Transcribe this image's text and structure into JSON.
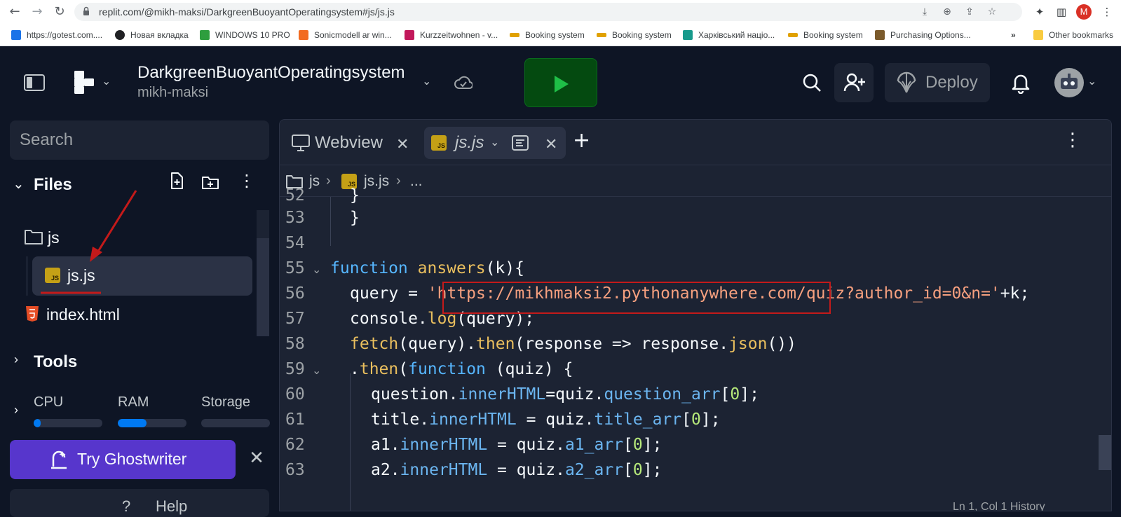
{
  "browser": {
    "url": "replit.com/@mikh-maksi/DarkgreenBuoyantOperatingsystem#js/js.js",
    "profile_initial": "M",
    "bookmarks": [
      {
        "label": "https://gotest.com....",
        "color": "#1a73e8"
      },
      {
        "label": "Новая вкладка",
        "color": "#202124"
      },
      {
        "label": "WINDOWS 10 PRO",
        "color": "#2e9e3e"
      },
      {
        "label": "Sonicmodell ar win...",
        "color": "#f26b21"
      },
      {
        "label": "Kurzzeitwohnen - v...",
        "color": "#c2185b"
      },
      {
        "label": "Booking system",
        "color": "#e0a100"
      },
      {
        "label": "Booking system",
        "color": "#e0a100"
      },
      {
        "label": "Харківський націо...",
        "color": "#179a8c"
      },
      {
        "label": "Booking system",
        "color": "#e0a100"
      },
      {
        "label": "Purchasing Options...",
        "color": "#7b5a2b"
      }
    ],
    "more_bookmarks": "»",
    "other_bookmarks": "Other bookmarks"
  },
  "header": {
    "repl_title": "DarkgreenBuoyantOperatingsystem",
    "owner": "mikh-maksi",
    "deploy_label": "Deploy"
  },
  "sidebar": {
    "search_placeholder": "Search",
    "files_label": "Files",
    "tree": [
      {
        "label": "js",
        "type": "folder"
      },
      {
        "label": "js.js",
        "type": "js",
        "selected": true
      },
      {
        "label": "index.html",
        "type": "html"
      }
    ],
    "tools_label": "Tools",
    "resources": [
      {
        "label": "CPU",
        "level": 0.1
      },
      {
        "label": "RAM",
        "level": 0.42
      },
      {
        "label": "Storage",
        "level": 0
      }
    ],
    "ghostwriter_label": "Try Ghostwriter",
    "help_label": "Help"
  },
  "editor": {
    "tabs": [
      {
        "label": "Webview",
        "active": false
      },
      {
        "label": "js.js",
        "active": true
      }
    ],
    "breadcrumb": [
      "js",
      "js.js",
      "..."
    ],
    "first_line_partial": "52",
    "line_numbers": [
      "53",
      "54",
      "55",
      "56",
      "57",
      "58",
      "59",
      "60",
      "61",
      "62",
      "63"
    ],
    "highlighted_url": "https://mikhmaksi2.pythonanywhere.com/",
    "status_text": "Ln 1, Col 1  History"
  },
  "colors": {
    "bg": "#0e1525",
    "panel": "#1c2333",
    "run_green": "#044a10",
    "ghostwriter_purple": "#5736cc",
    "annotation_red": "#c41a1a"
  }
}
